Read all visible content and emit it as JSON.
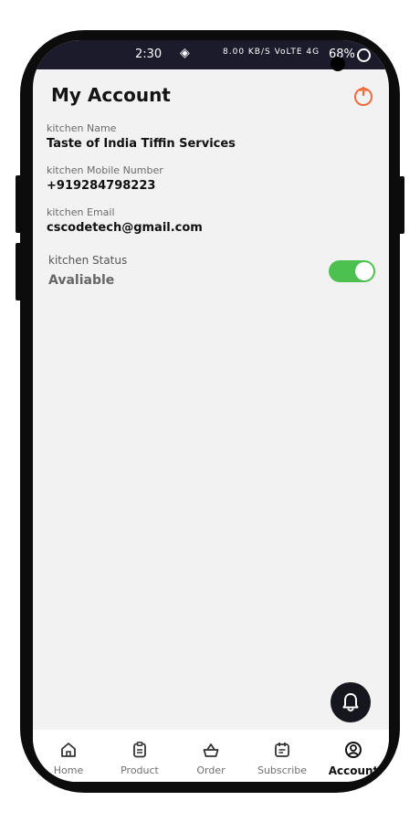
{
  "status_bar": {
    "time": "2:30",
    "network_text": "8.00 KB/S  VoLTE  4G",
    "battery": "68%"
  },
  "header": {
    "title": "My Account",
    "logout_icon": "power-icon"
  },
  "account": {
    "kitchen_name_label": "kitchen Name",
    "kitchen_name": "Taste of India Tiffin Services",
    "mobile_label": "kitchen Mobile Number",
    "mobile": "+919284798223",
    "email_label": "kitchen Email",
    "email": "cscodetech@gmail.com",
    "status_label": "kitchen Status",
    "status_value": "Avaliable",
    "status_on": true
  },
  "fab": {
    "icon": "bell-icon"
  },
  "nav": {
    "items": [
      {
        "label": "Home",
        "icon": "home-icon"
      },
      {
        "label": "Product",
        "icon": "clipboard-icon"
      },
      {
        "label": "Order",
        "icon": "basket-icon"
      },
      {
        "label": "Subscribe",
        "icon": "calendar-icon"
      },
      {
        "label": "Account",
        "icon": "user-icon"
      }
    ],
    "active_index": 4
  },
  "colors": {
    "accent": "#f26b3a",
    "toggle_on": "#4cc14f",
    "statusbar": "#1b1b2c"
  }
}
